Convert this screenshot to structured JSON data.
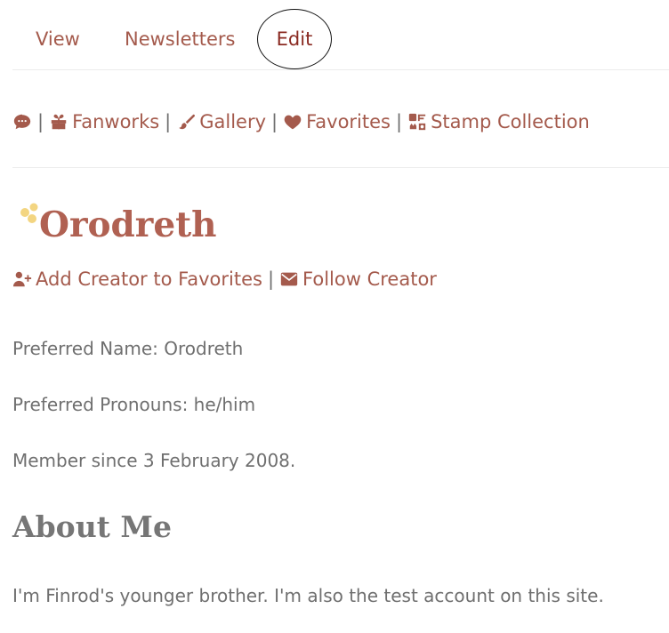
{
  "tabs": {
    "view": "View",
    "newsletters": "Newsletters",
    "edit": "Edit"
  },
  "subnav": {
    "separator": "|",
    "fanworks": "Fanworks",
    "gallery": "Gallery",
    "favorites": "Favorites",
    "stamp_collection": "Stamp Collection"
  },
  "creator": {
    "name": "Orodreth",
    "add_favorite": "Add Creator to Favorites",
    "follow": "Follow Creator",
    "separator": "|"
  },
  "profile": {
    "preferred_name": "Preferred Name: Orodreth",
    "preferred_pronouns": "Preferred Pronouns: he/him",
    "member_since": "Member since 3 February 2008."
  },
  "about": {
    "title": "About Me",
    "text": "I'm Finrod's younger brother. I'm also the test account on this site."
  },
  "colors": {
    "link": "#a45a4c",
    "name": "#b06152",
    "text": "#6f6f6f",
    "heading": "#767676",
    "divider": "#ececec",
    "stars": "#f2d37a"
  },
  "icons": {
    "chat": "chat-bubble-icon",
    "fanworks": "gift-icon",
    "gallery": "paintbrush-icon",
    "favorites": "heart-icon",
    "stamps": "stamp-collection-icon",
    "add_user": "user-plus-icon",
    "follow": "envelope-icon",
    "stars": "sparkle-icon"
  }
}
